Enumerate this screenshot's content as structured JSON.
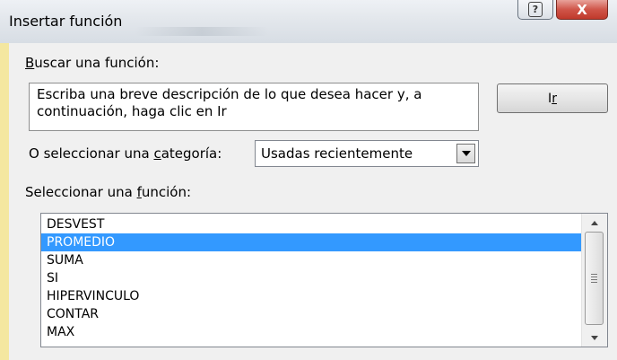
{
  "window": {
    "title": "Insertar función",
    "help_glyph": "?",
    "close_glyph": "X"
  },
  "search": {
    "label_prefix": "",
    "label_underlined": "B",
    "label_rest": "uscar una función:",
    "description": "Escriba una breve descripción de lo que desea hacer y, a continuación, haga clic en Ir",
    "go_label_main": "I",
    "go_label_underlined": "r"
  },
  "category": {
    "label_prefix": "O seleccionar una ",
    "label_underlined": "c",
    "label_rest": "ategoría:",
    "selected": "Usadas recientemente"
  },
  "functions": {
    "label_prefix": "Seleccionar una ",
    "label_underlined": "f",
    "label_rest": "unción:",
    "items": [
      "DESVEST",
      "PROMEDIO",
      "SUMA",
      "SI",
      "HIPERVINCULO",
      "CONTAR",
      "MAX"
    ],
    "selected_index": 1
  },
  "colors": {
    "selection": "#3399ff",
    "close_button": "#c0392b"
  }
}
